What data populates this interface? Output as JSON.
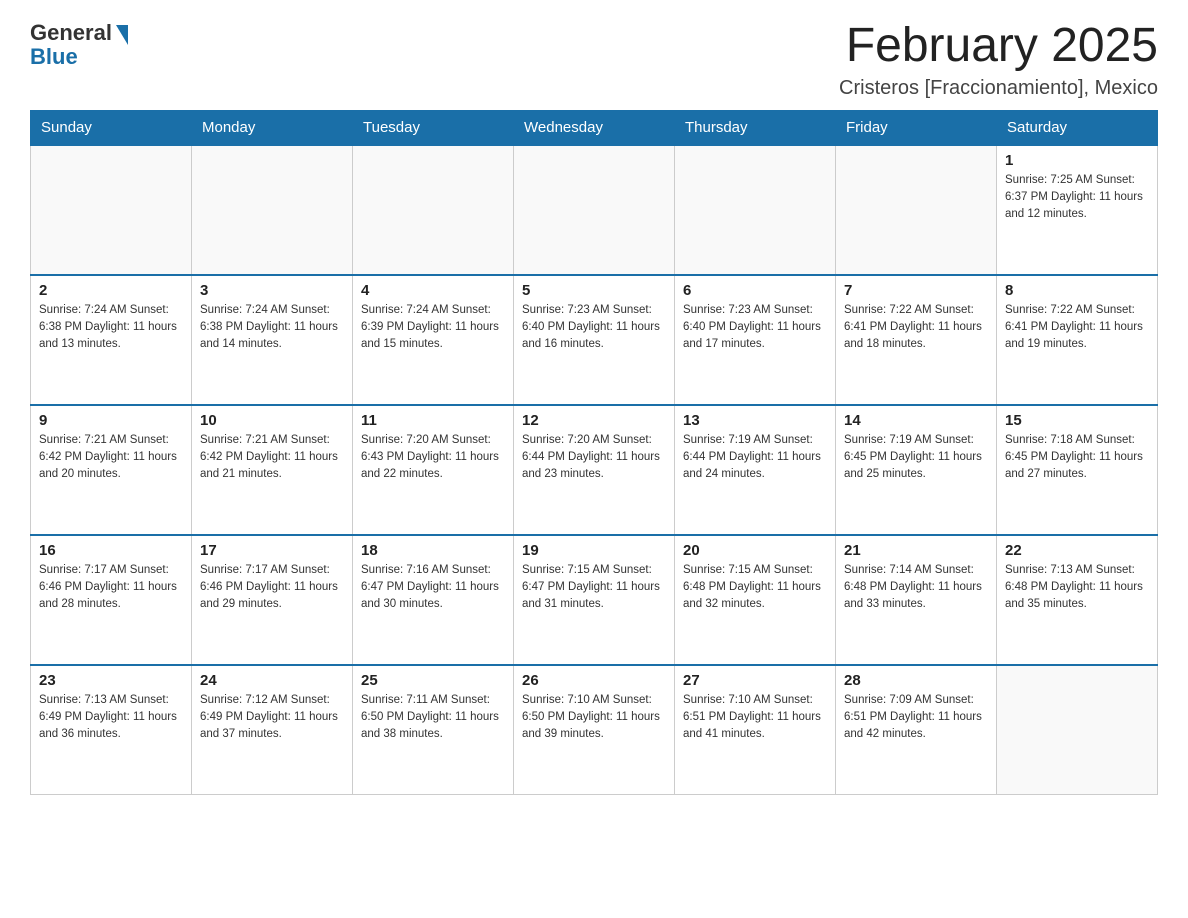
{
  "logo": {
    "general": "General",
    "blue": "Blue"
  },
  "title": "February 2025",
  "location": "Cristeros [Fraccionamiento], Mexico",
  "days_of_week": [
    "Sunday",
    "Monday",
    "Tuesday",
    "Wednesday",
    "Thursday",
    "Friday",
    "Saturday"
  ],
  "weeks": [
    [
      {
        "day": "",
        "info": ""
      },
      {
        "day": "",
        "info": ""
      },
      {
        "day": "",
        "info": ""
      },
      {
        "day": "",
        "info": ""
      },
      {
        "day": "",
        "info": ""
      },
      {
        "day": "",
        "info": ""
      },
      {
        "day": "1",
        "info": "Sunrise: 7:25 AM\nSunset: 6:37 PM\nDaylight: 11 hours\nand 12 minutes."
      }
    ],
    [
      {
        "day": "2",
        "info": "Sunrise: 7:24 AM\nSunset: 6:38 PM\nDaylight: 11 hours\nand 13 minutes."
      },
      {
        "day": "3",
        "info": "Sunrise: 7:24 AM\nSunset: 6:38 PM\nDaylight: 11 hours\nand 14 minutes."
      },
      {
        "day": "4",
        "info": "Sunrise: 7:24 AM\nSunset: 6:39 PM\nDaylight: 11 hours\nand 15 minutes."
      },
      {
        "day": "5",
        "info": "Sunrise: 7:23 AM\nSunset: 6:40 PM\nDaylight: 11 hours\nand 16 minutes."
      },
      {
        "day": "6",
        "info": "Sunrise: 7:23 AM\nSunset: 6:40 PM\nDaylight: 11 hours\nand 17 minutes."
      },
      {
        "day": "7",
        "info": "Sunrise: 7:22 AM\nSunset: 6:41 PM\nDaylight: 11 hours\nand 18 minutes."
      },
      {
        "day": "8",
        "info": "Sunrise: 7:22 AM\nSunset: 6:41 PM\nDaylight: 11 hours\nand 19 minutes."
      }
    ],
    [
      {
        "day": "9",
        "info": "Sunrise: 7:21 AM\nSunset: 6:42 PM\nDaylight: 11 hours\nand 20 minutes."
      },
      {
        "day": "10",
        "info": "Sunrise: 7:21 AM\nSunset: 6:42 PM\nDaylight: 11 hours\nand 21 minutes."
      },
      {
        "day": "11",
        "info": "Sunrise: 7:20 AM\nSunset: 6:43 PM\nDaylight: 11 hours\nand 22 minutes."
      },
      {
        "day": "12",
        "info": "Sunrise: 7:20 AM\nSunset: 6:44 PM\nDaylight: 11 hours\nand 23 minutes."
      },
      {
        "day": "13",
        "info": "Sunrise: 7:19 AM\nSunset: 6:44 PM\nDaylight: 11 hours\nand 24 minutes."
      },
      {
        "day": "14",
        "info": "Sunrise: 7:19 AM\nSunset: 6:45 PM\nDaylight: 11 hours\nand 25 minutes."
      },
      {
        "day": "15",
        "info": "Sunrise: 7:18 AM\nSunset: 6:45 PM\nDaylight: 11 hours\nand 27 minutes."
      }
    ],
    [
      {
        "day": "16",
        "info": "Sunrise: 7:17 AM\nSunset: 6:46 PM\nDaylight: 11 hours\nand 28 minutes."
      },
      {
        "day": "17",
        "info": "Sunrise: 7:17 AM\nSunset: 6:46 PM\nDaylight: 11 hours\nand 29 minutes."
      },
      {
        "day": "18",
        "info": "Sunrise: 7:16 AM\nSunset: 6:47 PM\nDaylight: 11 hours\nand 30 minutes."
      },
      {
        "day": "19",
        "info": "Sunrise: 7:15 AM\nSunset: 6:47 PM\nDaylight: 11 hours\nand 31 minutes."
      },
      {
        "day": "20",
        "info": "Sunrise: 7:15 AM\nSunset: 6:48 PM\nDaylight: 11 hours\nand 32 minutes."
      },
      {
        "day": "21",
        "info": "Sunrise: 7:14 AM\nSunset: 6:48 PM\nDaylight: 11 hours\nand 33 minutes."
      },
      {
        "day": "22",
        "info": "Sunrise: 7:13 AM\nSunset: 6:48 PM\nDaylight: 11 hours\nand 35 minutes."
      }
    ],
    [
      {
        "day": "23",
        "info": "Sunrise: 7:13 AM\nSunset: 6:49 PM\nDaylight: 11 hours\nand 36 minutes."
      },
      {
        "day": "24",
        "info": "Sunrise: 7:12 AM\nSunset: 6:49 PM\nDaylight: 11 hours\nand 37 minutes."
      },
      {
        "day": "25",
        "info": "Sunrise: 7:11 AM\nSunset: 6:50 PM\nDaylight: 11 hours\nand 38 minutes."
      },
      {
        "day": "26",
        "info": "Sunrise: 7:10 AM\nSunset: 6:50 PM\nDaylight: 11 hours\nand 39 minutes."
      },
      {
        "day": "27",
        "info": "Sunrise: 7:10 AM\nSunset: 6:51 PM\nDaylight: 11 hours\nand 41 minutes."
      },
      {
        "day": "28",
        "info": "Sunrise: 7:09 AM\nSunset: 6:51 PM\nDaylight: 11 hours\nand 42 minutes."
      },
      {
        "day": "",
        "info": ""
      }
    ]
  ]
}
